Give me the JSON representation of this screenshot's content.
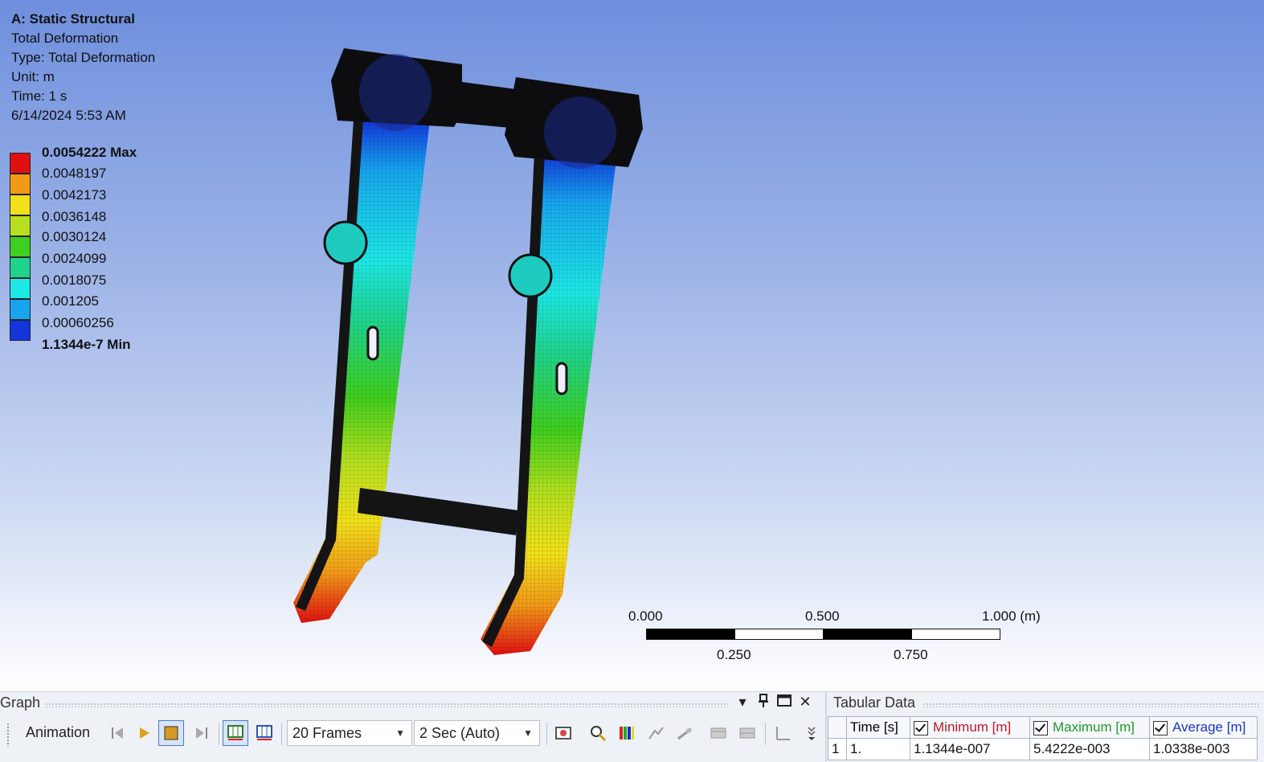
{
  "info": {
    "title": "A: Static Structural",
    "result_name": "Total Deformation",
    "type": "Type: Total Deformation",
    "unit": "Unit: m",
    "time": "Time: 1 s",
    "date": "6/14/2024 5:53 AM"
  },
  "legend": {
    "labels": [
      "0.0054222 Max",
      "0.0048197",
      "0.0042173",
      "0.0036148",
      "0.0030124",
      "0.0024099",
      "0.0018075",
      "0.001205",
      "0.00060256",
      "1.1344e-7 Min"
    ],
    "colors": [
      "#e01010",
      "#f29a18",
      "#f2e01a",
      "#b6e01e",
      "#3fcf1e",
      "#1ed48c",
      "#1ee8e6",
      "#16a6ee",
      "#1236dc"
    ]
  },
  "scale_bar": {
    "top_labels": [
      "0.000",
      "0.500",
      "1.000 (m)"
    ],
    "bottom_labels": [
      "0.250",
      "0.750"
    ]
  },
  "graph_panel": {
    "title": "Graph",
    "animation_label": "Animation",
    "frames_value": "20 Frames",
    "duration_value": "2 Sec (Auto)"
  },
  "tabular_panel": {
    "title": "Tabular Data",
    "headers": [
      "Time [s]",
      "Minimum [m]",
      "Maximum [m]",
      "Average [m]"
    ],
    "header_colors": [
      "#222222",
      "#c0182a",
      "#1f9a2a",
      "#1a36c8"
    ],
    "rows": [
      {
        "index": "1",
        "time": "1.",
        "minimum": "1.1344e-007",
        "maximum": "5.4222e-003",
        "average": "1.0338e-003"
      }
    ]
  },
  "icons": [
    "skip-back-icon",
    "play-icon",
    "stop-icon",
    "skip-forward-icon",
    "distributed-frames-icon",
    "result-frames-icon",
    "export-video-icon",
    "zoom-icon",
    "legend-icon",
    "probe-icon",
    "pin-icon",
    "window-icon",
    "close-icon"
  ]
}
